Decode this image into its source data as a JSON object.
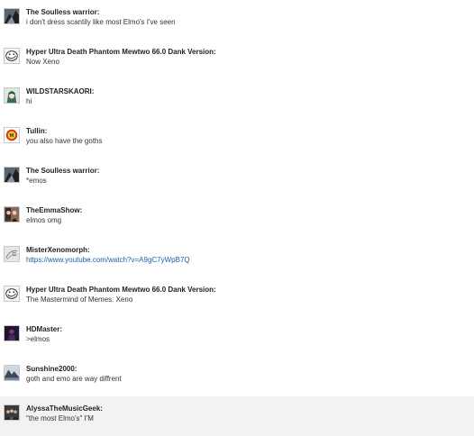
{
  "messages": [
    {
      "username": "The Soulless warrior:",
      "text": "i don't dress scantily like most Elmo's I've seen",
      "avatar": "warrior-avatar",
      "highlighted": false
    },
    {
      "username": "Hyper Ultra Death Phantom Mewtwo 66.0 Dank Version:",
      "text": "Now Xeno",
      "avatar": "meme-face-avatar",
      "highlighted": false
    },
    {
      "username": "WILDSTARSKAORI:",
      "text": "hi",
      "avatar": "anime-avatar",
      "highlighted": false
    },
    {
      "username": "Tullin:",
      "text": "you also have the goths",
      "avatar": "emblem-avatar",
      "highlighted": false
    },
    {
      "username": "The Soulless warrior:",
      "text": "*emos",
      "avatar": "warrior-avatar",
      "highlighted": false
    },
    {
      "username": "TheEmmaShow:",
      "text": "elmos omg",
      "avatar": "photo-avatar",
      "highlighted": false
    },
    {
      "username": "MisterXenomorph:",
      "text": "https://www.youtube.com/watch?v=A9gC7yWpB7Q",
      "link": true,
      "avatar": "sketch-avatar",
      "highlighted": false
    },
    {
      "username": "Hyper Ultra Death Phantom Mewtwo 66.0 Dank Version:",
      "text": "The Mastermind of Memes: Xeno",
      "avatar": "meme-face-avatar",
      "highlighted": false
    },
    {
      "username": "HDMaster:",
      "text": ">elmos",
      "avatar": "dark-figure-avatar",
      "highlighted": false
    },
    {
      "username": "Sunshine2000:",
      "text": "goth and emo are way diffrent",
      "avatar": "landscape-avatar",
      "highlighted": false
    },
    {
      "username": "AlyssaTheMusicGeek:",
      "text": "\"the most Elmo's\" I'M",
      "avatar": "group-photo-avatar",
      "highlighted": true
    }
  ]
}
